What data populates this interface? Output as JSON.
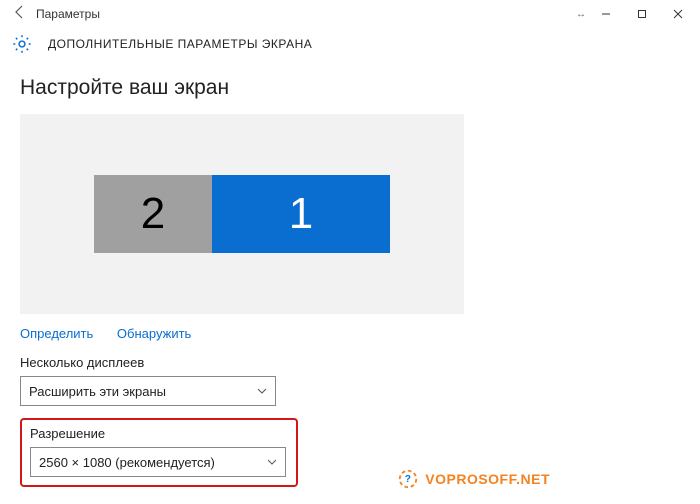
{
  "titlebar": {
    "app_title": "Параметры"
  },
  "header": {
    "section_title": "ДОПОЛНИТЕЛЬНЫЕ ПАРАМЕТРЫ ЭКРАНА"
  },
  "main": {
    "heading": "Настройте ваш экран",
    "monitors": {
      "secondary_label": "2",
      "primary_label": "1"
    },
    "identify_link": "Определить",
    "detect_link": "Обнаружить",
    "multi_displays": {
      "label": "Несколько дисплеев",
      "value": "Расширить эти экраны"
    },
    "resolution": {
      "label": "Разрешение",
      "value": "2560 × 1080 (рекомендуется)"
    }
  },
  "watermark": {
    "text": "VOPROSOFF.NET"
  }
}
